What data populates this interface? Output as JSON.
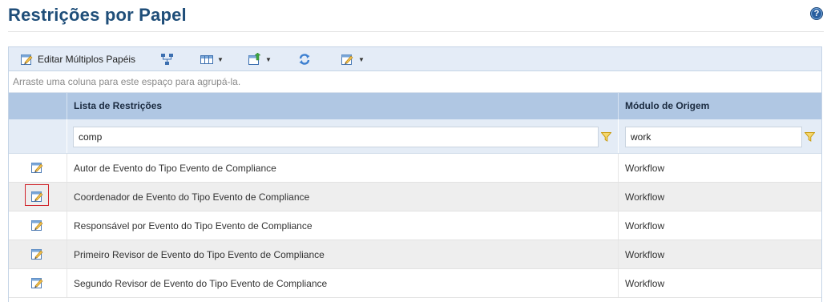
{
  "page": {
    "title": "Restrições por Papel"
  },
  "toolbar": {
    "edit_multiple_label": "Editar Múltiplos Papéis"
  },
  "group_panel": {
    "hint": "Arraste uma coluna para este espaço para agrupá-la."
  },
  "columns": {
    "restrictions": "Lista de Restrições",
    "origin": "Módulo de Origem"
  },
  "filters": {
    "restrictions_value": "comp",
    "origin_value": "work"
  },
  "rows": [
    {
      "restriction": "Autor de Evento do Tipo Evento de Compliance",
      "origin": "Workflow",
      "highlighted": false
    },
    {
      "restriction": "Coordenador de Evento do Tipo Evento de Compliance",
      "origin": "Workflow",
      "highlighted": true
    },
    {
      "restriction": "Responsável por Evento do Tipo Evento de Compliance",
      "origin": "Workflow",
      "highlighted": false
    },
    {
      "restriction": "Primeiro Revisor de Evento do Tipo Evento de Compliance",
      "origin": "Workflow",
      "highlighted": false
    },
    {
      "restriction": "Segundo Revisor de Evento do Tipo Evento de Compliance",
      "origin": "Workflow",
      "highlighted": false
    }
  ],
  "colors": {
    "title": "#1f4e79",
    "toolbar_bg": "#e4ecf7",
    "header_bg": "#b0c7e3",
    "filter_bg": "#e4ecf6",
    "alt_row": "#eeeeee",
    "highlight_border": "#d0232a",
    "funnel": "#e8b917"
  },
  "icons": [
    "help-icon",
    "edit-multiple-icon",
    "hierarchy-icon",
    "columns-icon",
    "export-icon",
    "refresh-icon",
    "edit-menu-icon",
    "filter-icon",
    "edit-icon"
  ]
}
